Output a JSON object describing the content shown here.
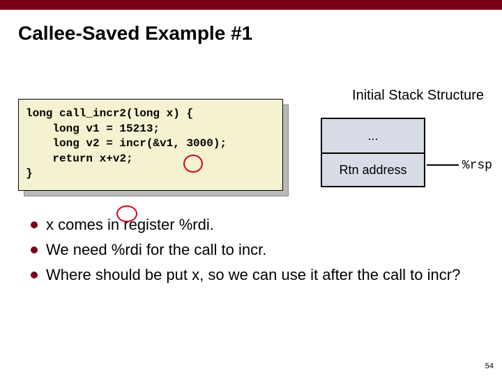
{
  "title": "Callee-Saved Example #1",
  "code": {
    "l1a": "long call_incr2(long ",
    "l1b": "x",
    "l1c": ") {",
    "l2": "    long v1 = 15213;",
    "l3": "    long v2 = incr(&v1, 3000);",
    "l4a": "    return ",
    "l4b": "x",
    "l4c": "+v2;",
    "l5": "}"
  },
  "stack": {
    "title": "Initial Stack Structure",
    "cells": [
      "...",
      "Rtn address"
    ],
    "ptr": "%rsp"
  },
  "bullets": [
    "x comes in register %rdi.",
    "We need %rdi for the call to incr.",
    "Where should be put x, so we can use it after the call to incr?"
  ],
  "page": "54"
}
